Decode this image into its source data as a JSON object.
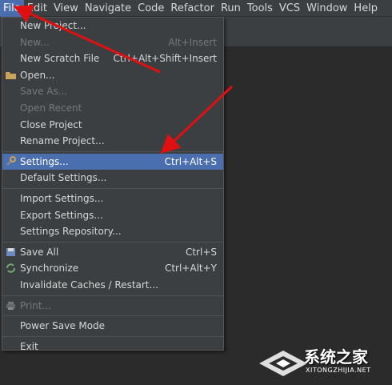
{
  "menubar": {
    "items": [
      {
        "label": "File",
        "active": true
      },
      {
        "label": "Edit"
      },
      {
        "label": "View"
      },
      {
        "label": "Navigate"
      },
      {
        "label": "Code"
      },
      {
        "label": "Refactor"
      },
      {
        "label": "Run"
      },
      {
        "label": "Tools"
      },
      {
        "label": "VCS"
      },
      {
        "label": "Window"
      },
      {
        "label": "Help"
      }
    ]
  },
  "file_menu": {
    "items": [
      {
        "label": "New Project...",
        "shortcut": ""
      },
      {
        "label": "New...",
        "shortcut": "Alt+Insert",
        "disabled": true
      },
      {
        "label": "New Scratch File",
        "shortcut": "Ctrl+Alt+Shift+Insert"
      },
      {
        "label": "Open...",
        "shortcut": "",
        "icon": "folder-icon"
      },
      {
        "label": "Save As...",
        "shortcut": "",
        "disabled": true
      },
      {
        "label": "Open Recent",
        "shortcut": "",
        "disabled": true
      },
      {
        "label": "Close Project",
        "shortcut": ""
      },
      {
        "label": "Rename Project...",
        "shortcut": ""
      },
      {
        "sep": true
      },
      {
        "label": "Settings...",
        "shortcut": "Ctrl+Alt+S",
        "selected": true,
        "icon": "settings-wrench-icon"
      },
      {
        "label": "Default Settings...",
        "shortcut": ""
      },
      {
        "sep": true
      },
      {
        "label": "Import Settings...",
        "shortcut": ""
      },
      {
        "label": "Export Settings...",
        "shortcut": ""
      },
      {
        "label": "Settings Repository...",
        "shortcut": ""
      },
      {
        "sep": true
      },
      {
        "label": "Save All",
        "shortcut": "Ctrl+S",
        "icon": "save-icon"
      },
      {
        "label": "Synchronize",
        "shortcut": "Ctrl+Alt+Y",
        "icon": "sync-icon"
      },
      {
        "label": "Invalidate Caches / Restart...",
        "shortcut": ""
      },
      {
        "sep": true
      },
      {
        "label": "Print...",
        "shortcut": "",
        "disabled": true,
        "icon": "print-icon"
      },
      {
        "sep": true
      },
      {
        "label": "Power Save Mode",
        "shortcut": ""
      },
      {
        "sep": true
      },
      {
        "label": "Exit",
        "shortcut": ""
      }
    ]
  },
  "watermark": {
    "title": "系统之家",
    "subtitle": "XITONGZHIJIA.NET"
  },
  "colors": {
    "menu_bg": "#3c3f41",
    "selection": "#4b6eaf",
    "arrow": "#e01010"
  }
}
